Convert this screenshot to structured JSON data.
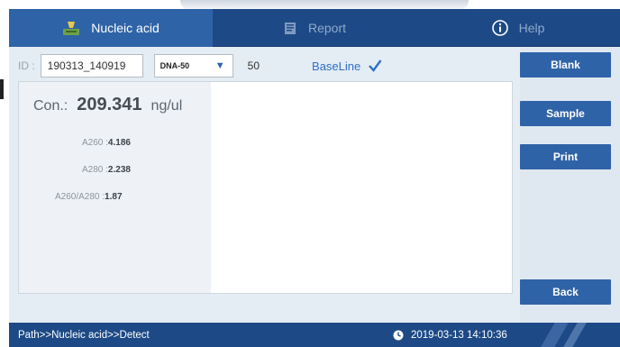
{
  "tabs": [
    {
      "label": "Nucleic acid",
      "active": true,
      "icon": "flask-icon"
    },
    {
      "label": "Report",
      "active": false,
      "icon": "report-icon"
    },
    {
      "label": "Help",
      "active": false,
      "icon": "info-icon"
    }
  ],
  "idrow": {
    "id_label": "ID :",
    "id_value": "190313_140919",
    "dna_select": "DNA-50",
    "factor": "50",
    "baseline_label": "BaseLine",
    "baseline_checked": true
  },
  "result": {
    "con_label": "Con.:",
    "con_value": "209.341",
    "con_unit": "ng/ul",
    "a260_label": "A260 :",
    "a260_value": "4.186",
    "a280_label": "A280 :",
    "a280_value": "2.238",
    "ratio_label": "A260/A280 :",
    "ratio_value": "1.87"
  },
  "buttons": {
    "blank": "Blank",
    "sample": "Sample",
    "print": "Print",
    "back": "Back"
  },
  "status": {
    "path": "Path>>Nucleic acid>>Detect",
    "datetime": "2019-03-13 14:10:36"
  },
  "colors": {
    "primary": "#2f63a7",
    "dark": "#1d4a86",
    "accent_text": "#2f6fc4"
  }
}
